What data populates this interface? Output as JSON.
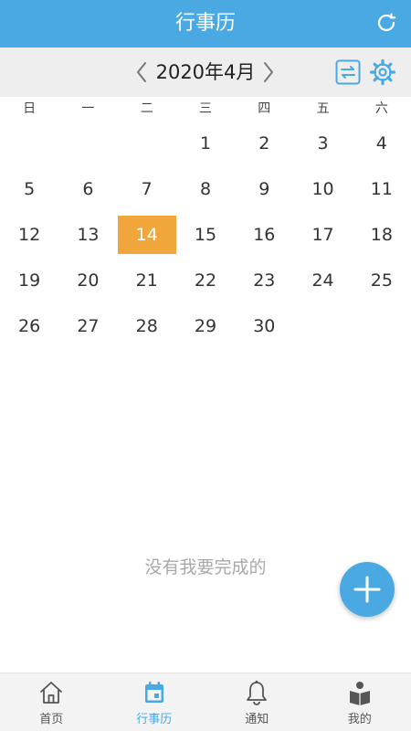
{
  "header": {
    "title": "行事历",
    "refresh_icon": "refresh-icon"
  },
  "month_nav": {
    "label": "2020年4月",
    "prev_icon": "chevron-left-icon",
    "next_icon": "chevron-right-icon",
    "switch_icon": "swap-icon",
    "settings_icon": "gear-icon"
  },
  "calendar": {
    "weekdays": [
      "日",
      "一",
      "二",
      "三",
      "四",
      "五",
      "六"
    ],
    "leading_blanks": 3,
    "days": [
      "1",
      "2",
      "3",
      "4",
      "5",
      "6",
      "7",
      "8",
      "9",
      "10",
      "11",
      "12",
      "13",
      "14",
      "15",
      "16",
      "17",
      "18",
      "19",
      "20",
      "21",
      "22",
      "23",
      "24",
      "25",
      "26",
      "27",
      "28",
      "29",
      "30"
    ],
    "selected_day": "14"
  },
  "empty_state": {
    "text": "没有我要完成的"
  },
  "fab": {
    "icon": "plus-icon"
  },
  "bottom_nav": {
    "items": [
      {
        "label": "首页",
        "icon": "home-icon"
      },
      {
        "label": "行事历",
        "icon": "calendar-icon"
      },
      {
        "label": "通知",
        "icon": "bell-icon"
      },
      {
        "label": "我的",
        "icon": "reading-person-icon"
      }
    ],
    "active_index": 1
  },
  "colors": {
    "primary": "#4aa9e3",
    "selected_day_bg": "#f0a63a",
    "monthbar_bg": "#eeeeee",
    "bottom_nav_bg": "#f3f3f3",
    "empty_text": "#a8a8a8"
  }
}
